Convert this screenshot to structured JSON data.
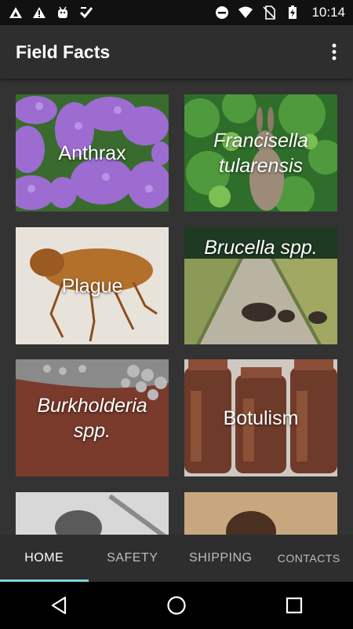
{
  "status_bar": {
    "time": "10:14",
    "left_icons": [
      "account-a-icon",
      "warning-icon",
      "android-icon",
      "checkmark-icon"
    ],
    "right_icons": [
      "do-not-disturb-icon",
      "wifi-icon",
      "no-sim-icon",
      "battery-charging-icon"
    ]
  },
  "app_bar": {
    "title": "Field Facts",
    "menu_icon": "more-vert-icon"
  },
  "tiles": [
    {
      "label": "Anthrax"
    },
    {
      "label": "Francisella\ntularensis"
    },
    {
      "label": "Plague"
    },
    {
      "label": "Brucella spp."
    },
    {
      "label": "Burkholderia\nspp."
    },
    {
      "label": "Botulism"
    },
    {
      "label": ""
    },
    {
      "label": ""
    }
  ],
  "bottom_nav": {
    "tabs": [
      {
        "label": "HOME",
        "active": true
      },
      {
        "label": "SAFETY",
        "active": false
      },
      {
        "label": "SHIPPING",
        "active": false
      },
      {
        "label": "CONTACTS",
        "active": false
      }
    ]
  },
  "system_nav": [
    "back-icon",
    "home-icon",
    "recents-icon"
  ],
  "colors": {
    "accent": "#7fd3d8",
    "app_bar": "#2e2e2e",
    "status_bar": "#111111"
  }
}
